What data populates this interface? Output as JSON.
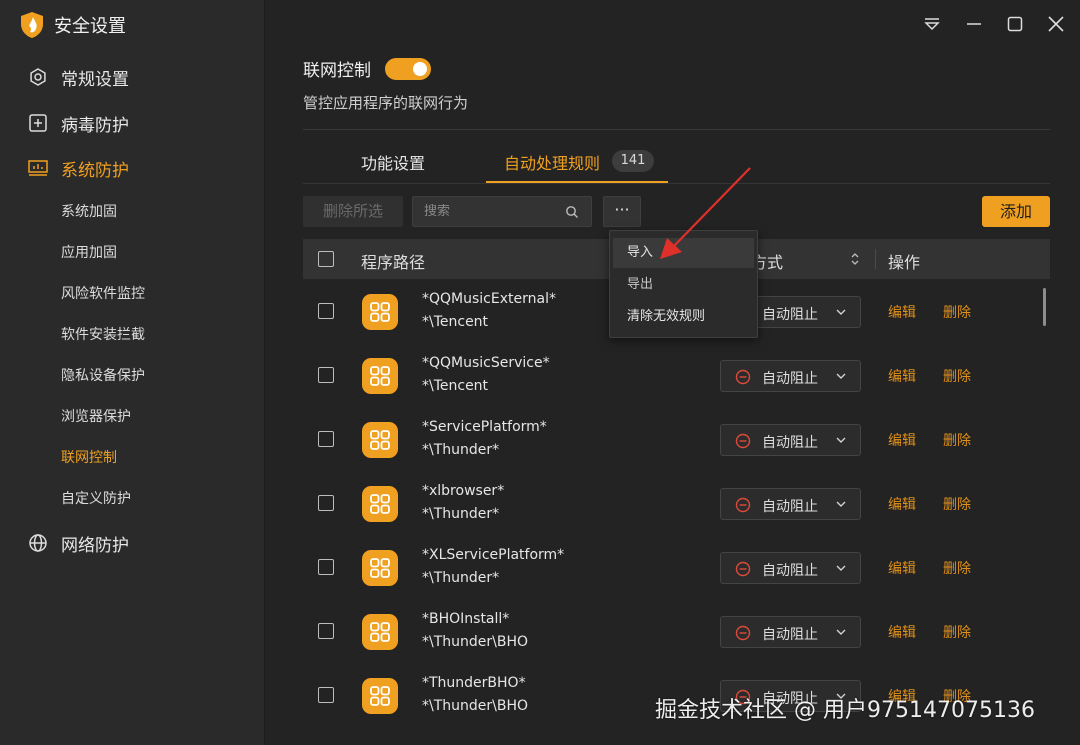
{
  "app": {
    "title": "安全设置",
    "accent": "#f0a020"
  },
  "sidebar": {
    "main_items": [
      {
        "label": "常规设置",
        "icon": "gear-icon"
      },
      {
        "label": "病毒防护",
        "icon": "plus-square-icon"
      },
      {
        "label": "系统防护",
        "icon": "monitor-icon",
        "active": true
      },
      {
        "label": "网络防护",
        "icon": "globe-icon"
      }
    ],
    "sub_items": [
      {
        "label": "系统加固"
      },
      {
        "label": "应用加固"
      },
      {
        "label": "风险软件监控"
      },
      {
        "label": "软件安装拦截"
      },
      {
        "label": "隐私设备保护"
      },
      {
        "label": "浏览器保护"
      },
      {
        "label": "联网控制",
        "active": true
      },
      {
        "label": "自定义防护"
      }
    ]
  },
  "header": {
    "title": "联网控制",
    "toggle_on": true,
    "description": "管控应用程序的联网行为"
  },
  "tabs": [
    {
      "label": "功能设置"
    },
    {
      "label": "自动处理规则",
      "badge": "141",
      "active": true
    }
  ],
  "toolbar": {
    "delete_selected": "删除所选",
    "search_placeholder": "搜索",
    "more": "···",
    "add": "添加"
  },
  "table": {
    "columns": {
      "path": "程序路径",
      "method": "方式",
      "ops": "操作"
    },
    "rows": [
      {
        "name": "*QQMusicExternal*",
        "path": "*\\Tencent",
        "action": "自动阻止",
        "edit": "编辑",
        "delete": "删除"
      },
      {
        "name": "*QQMusicService*",
        "path": "*\\Tencent",
        "action": "自动阻止",
        "edit": "编辑",
        "delete": "删除"
      },
      {
        "name": "*ServicePlatform*",
        "path": "*\\Thunder*",
        "action": "自动阻止",
        "edit": "编辑",
        "delete": "删除"
      },
      {
        "name": "*xlbrowser*",
        "path": "*\\Thunder*",
        "action": "自动阻止",
        "edit": "编辑",
        "delete": "删除"
      },
      {
        "name": "*XLServicePlatform*",
        "path": "*\\Thunder*",
        "action": "自动阻止",
        "edit": "编辑",
        "delete": "删除"
      },
      {
        "name": "*BHOInstall*",
        "path": "*\\Thunder\\BHO",
        "action": "自动阻止",
        "edit": "编辑",
        "delete": "删除"
      },
      {
        "name": "*ThunderBHO*",
        "path": "*\\Thunder\\BHO",
        "action": "自动阻止",
        "edit": "编辑",
        "delete": "删除"
      }
    ]
  },
  "menu": {
    "items": [
      {
        "label": "导入"
      },
      {
        "label": "导出"
      },
      {
        "label": "清除无效规则"
      }
    ]
  },
  "watermark": "掘金技术社区 @ 用户975147075136"
}
